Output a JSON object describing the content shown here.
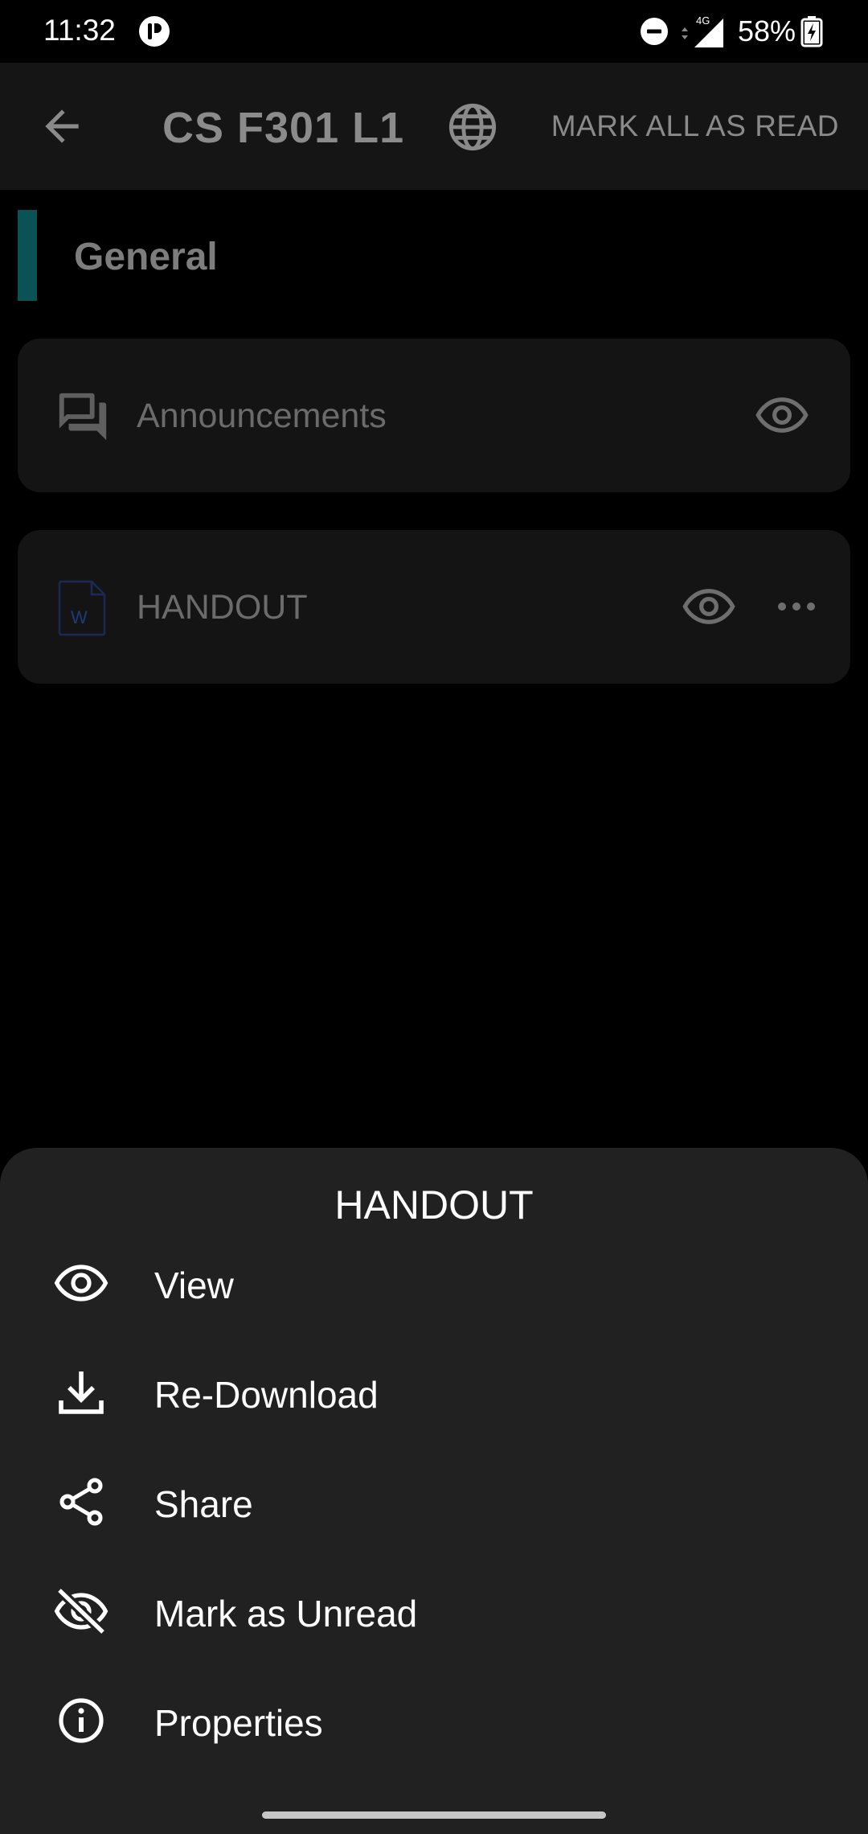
{
  "status_bar": {
    "time": "11:32",
    "network": "4G",
    "battery": "58%",
    "icons": [
      "app-notification-icon",
      "do-not-disturb-icon",
      "signal-icon",
      "battery-charging-icon"
    ]
  },
  "app_bar": {
    "back_icon": "arrow-back-icon",
    "title": "CS F301 L1",
    "globe_icon": "globe-icon",
    "mark_all_read": "MARK ALL AS READ"
  },
  "section": {
    "title": "General",
    "accent_color": "#0b5257"
  },
  "items": [
    {
      "label": "Announcements",
      "icon": "forum-icon",
      "actions": [
        "eye-icon"
      ]
    },
    {
      "label": "HANDOUT",
      "icon": "word-document-icon",
      "file_badge": "W",
      "actions": [
        "eye-icon",
        "more-horizontal-icon"
      ]
    }
  ],
  "sheet": {
    "title": "HANDOUT",
    "options": [
      {
        "label": "View",
        "icon": "eye-icon"
      },
      {
        "label": "Re-Download",
        "icon": "download-icon"
      },
      {
        "label": "Share",
        "icon": "share-icon"
      },
      {
        "label": "Mark as Unread",
        "icon": "eye-off-icon"
      },
      {
        "label": "Properties",
        "icon": "info-icon"
      }
    ]
  },
  "colors": {
    "background": "#000000",
    "sheet": "#212121",
    "card": "#141414",
    "accent": "#0b5257"
  }
}
